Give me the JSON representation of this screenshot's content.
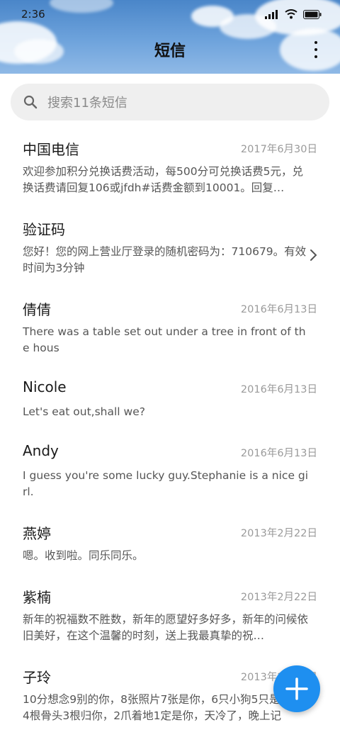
{
  "status_bar": {
    "time": "2:36"
  },
  "header": {
    "title": "短信"
  },
  "search": {
    "placeholder": "搜索11条短信"
  },
  "messages": [
    {
      "sender": "中国电信",
      "date": "2017年6月30日",
      "preview": "欢迎参加积分兑换话费活动，每500分可兑换话费5元，兑换话费请回复106或jfdh#话费金额到10001。回复…"
    },
    {
      "sender": "验证码",
      "date": "",
      "preview": "您好！您的网上营业厅登录的随机密码为：710679。有效时间为3分钟"
    },
    {
      "sender": "倩倩",
      "date": "2016年6月13日",
      "preview": "There was a table set out under a tree in front of the hous"
    },
    {
      "sender": "Nicole",
      "date": "2016年6月13日",
      "preview": "Let's eat out,shall we?"
    },
    {
      "sender": "Andy",
      "date": "2016年6月13日",
      "preview": "I guess you're some lucky guy.Stephanie is a nice girl."
    },
    {
      "sender": "燕婷",
      "date": "2013年2月22日",
      "preview": "嗯。收到啦。同乐同乐。"
    },
    {
      "sender": "紫楠",
      "date": "2013年2月22日",
      "preview": "新年的祝福数不胜数，新年的愿望好多好多，新年的问候依旧美好，在这个温馨的时刻，送上我最真挚的祝…"
    },
    {
      "sender": "子玲",
      "date": "2013年2月22日",
      "preview": "10分想念9别的你，8张照片7张是你，6只小狗5只是你，4根骨头3根归你，2爪着地1定是你，天冷了，晚上记"
    }
  ],
  "colors": {
    "accent": "#1e8ff0",
    "sky": "#6ea3dc"
  },
  "icons": {
    "search": "search-icon",
    "more": "more-vertical-icon",
    "chevron": "chevron-right-icon",
    "compose": "plus-icon"
  }
}
